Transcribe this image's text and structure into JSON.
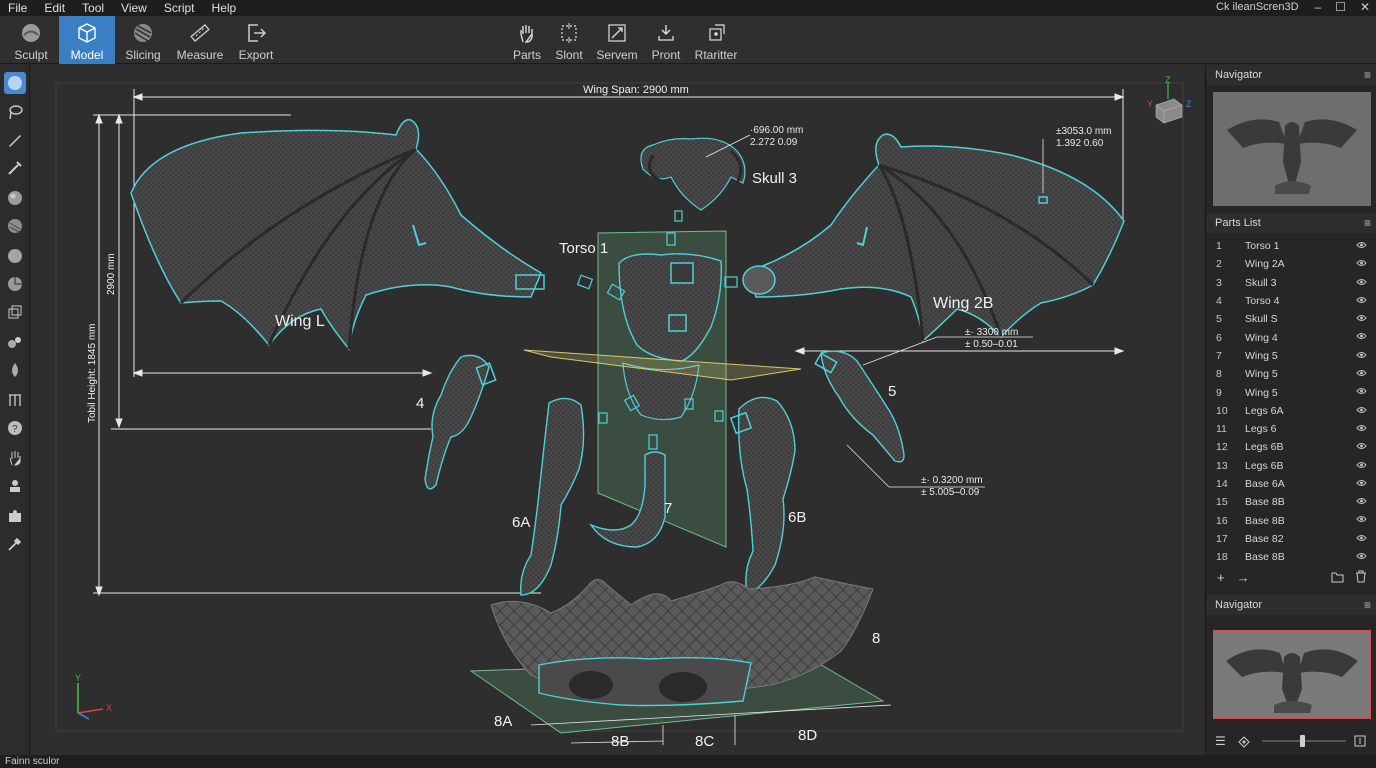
{
  "menu": [
    "File",
    "Edit",
    "Tool",
    "View",
    "Script",
    "Help"
  ],
  "app_title": "Ck ileanScren3D",
  "window_buttons": [
    "–",
    "☐",
    "✕"
  ],
  "toolbar": {
    "left": [
      {
        "label": "Sculpt",
        "icon": "sphere-icon"
      },
      {
        "label": "Model",
        "icon": "cube-icon"
      },
      {
        "label": "Slicing",
        "icon": "slicing-sphere-icon"
      },
      {
        "label": "Measure",
        "icon": "ruler-icon"
      },
      {
        "label": "Export",
        "icon": "export-icon"
      }
    ],
    "active": "Model",
    "center": [
      {
        "label": "Parts",
        "icon": "hand-icon"
      },
      {
        "label": "Slont",
        "icon": "select-box-icon"
      },
      {
        "label": "Servem",
        "icon": "scale-icon"
      },
      {
        "label": "Pront",
        "icon": "print-icon"
      },
      {
        "label": "Rtaritter",
        "icon": "transform-icon"
      }
    ]
  },
  "viewport": {
    "labels": {
      "wing_span": "Wing Span: 2900 mm",
      "total_height": "Tobil Height: 1845 mm",
      "height_2900": "2900 mm",
      "skull": "Skull 3",
      "torso": "Torso 1",
      "wing_l": "Wing L",
      "wing_2b": "Wing 2B",
      "part_4": "4",
      "part_5": "5",
      "part_6a": "6A",
      "part_6b": "6B",
      "part_7": "7",
      "part_8": "8",
      "part_8a": "8A",
      "part_8b": "8B",
      "part_8c": "8C",
      "part_8d": "8D"
    },
    "dims": {
      "skull_dim_1": "·696.00 mm",
      "skull_dim_2": "2.272 0.09",
      "wing_r_dim_1": "±3053.0 mm",
      "wing_r_dim_2": "1.392 0.60",
      "arm_dim_1": "±· 3300 mm",
      "arm_dim_2": "± 0.50–0.01",
      "leg_dim_1": "±· 0.3200 mm",
      "leg_dim_2": "± 5.005–0.09"
    },
    "axis": {
      "x": "X",
      "y": "Y",
      "z": "Z"
    },
    "colors": {
      "outline": "#4fd0d8",
      "plane_green": "#6fbf8a",
      "plane_yellow": "#d8c86a"
    }
  },
  "panels": {
    "navigator_title": "Navigator",
    "parts_title": "Parts List",
    "navigator2_title": "Navigator",
    "parts": [
      {
        "num": "1",
        "name": "Torso 1"
      },
      {
        "num": "2",
        "name": "Wing 2A"
      },
      {
        "num": "3",
        "name": "Skull 3"
      },
      {
        "num": "4",
        "name": "Torso 4"
      },
      {
        "num": "5",
        "name": "Skull S"
      },
      {
        "num": "6",
        "name": "Wing 4"
      },
      {
        "num": "7",
        "name": "Wing 5"
      },
      {
        "num": "8",
        "name": "Wing 5"
      },
      {
        "num": "9",
        "name": "Wing 5"
      },
      {
        "num": "10",
        "name": "Legs 6A"
      },
      {
        "num": "11",
        "name": "Legs 6"
      },
      {
        "num": "12",
        "name": "Legs 6B"
      },
      {
        "num": "13",
        "name": "Legs 6B"
      },
      {
        "num": "14",
        "name": "Base 6A"
      },
      {
        "num": "15",
        "name": "Base 8B"
      },
      {
        "num": "16",
        "name": "Base 8B"
      },
      {
        "num": "17",
        "name": "Base 82"
      },
      {
        "num": "18",
        "name": "Base 8B"
      }
    ],
    "parts_footer": {
      "add": "+",
      "arrow": "→"
    }
  },
  "status": "Fainn sculor"
}
